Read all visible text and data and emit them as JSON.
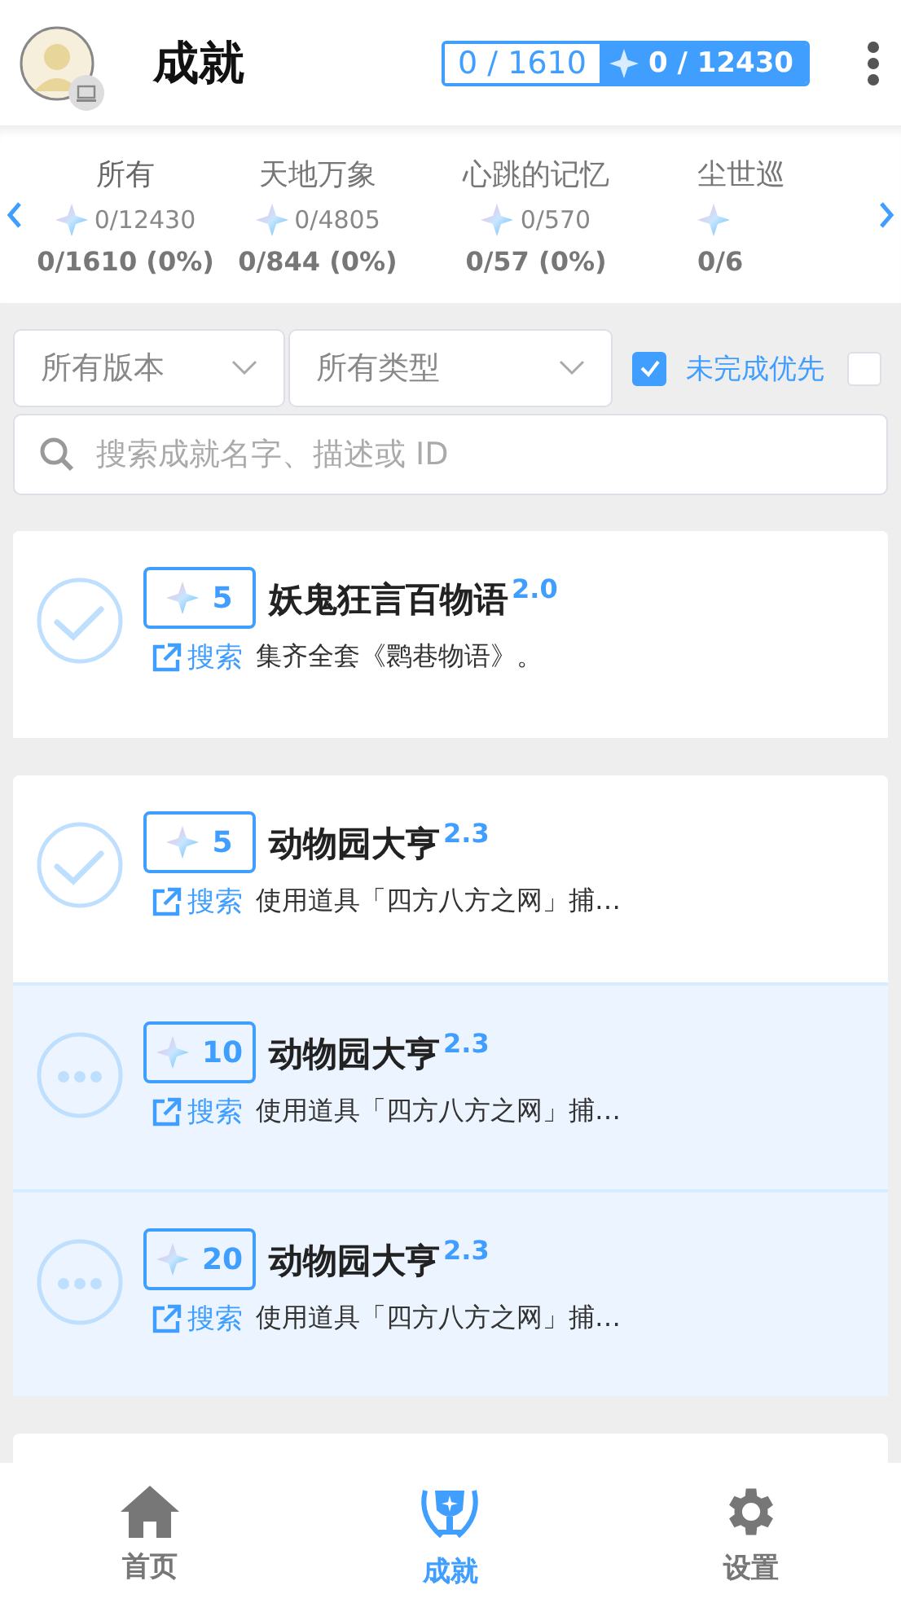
{
  "header": {
    "title": "成就",
    "achieved_count": "0 / 1610",
    "primogem_count": "0 / 12430"
  },
  "categories": [
    {
      "name": "所有",
      "primogems": "0/12430",
      "progress": "0/1610 (0%)",
      "selected": true
    },
    {
      "name": "天地万象",
      "primogems": "0/4805",
      "progress": "0/844 (0%)",
      "selected": false
    },
    {
      "name": "心跳的记忆",
      "primogems": "0/570",
      "progress": "0/57 (0%)",
      "selected": false
    },
    {
      "name": "尘世巡",
      "progress": "0/6",
      "selected": false
    }
  ],
  "filters": {
    "version": "所有版本",
    "type": "所有类型",
    "options": [
      {
        "label": "未完成优先",
        "checked": true
      },
      {
        "checked": false
      }
    ]
  },
  "search": {
    "placeholder": "搜索成就名字、描述或 ID"
  },
  "groups": [
    {
      "items": [
        {
          "completed": false,
          "done_mark": true,
          "reward": "5",
          "title": "妖鬼狂言百物语",
          "version": "2.0",
          "link": "搜索",
          "description": "集齐全套《鹮巷物语》。"
        }
      ]
    },
    {
      "items": [
        {
          "completed": false,
          "done_mark": true,
          "reward": "5",
          "title": "动物园大亨",
          "version": "2.3",
          "link": "搜索",
          "description": "使用道具「四方八方之网」捕…"
        },
        {
          "completed": false,
          "done_mark": false,
          "reward": "10",
          "title": "动物园大亨",
          "version": "2.3",
          "link": "搜索",
          "description": "使用道具「四方八方之网」捕…"
        },
        {
          "completed": false,
          "done_mark": false,
          "reward": "20",
          "title": "动物园大亨",
          "version": "2.3",
          "link": "搜索",
          "description": "使用道具「四方八方之网」捕…"
        }
      ]
    },
    {
      "kind": "peek"
    }
  ],
  "nav": [
    {
      "kind": "home",
      "label": "首页",
      "selected": false
    },
    {
      "kind": "achievements",
      "label": "成就",
      "selected": true
    },
    {
      "kind": "settings",
      "label": "设置",
      "selected": false
    }
  ]
}
